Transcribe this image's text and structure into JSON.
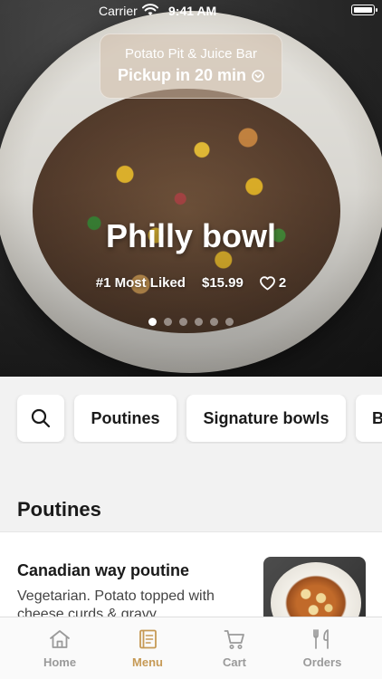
{
  "status_bar": {
    "carrier": "Carrier",
    "time": "9:41 AM"
  },
  "pickup": {
    "store": "Potato Pit & Juice Bar",
    "time_label": "Pickup in 20 min"
  },
  "featured": {
    "title": "Philly bowl",
    "badge": "#1 Most Liked",
    "price": "$15.99",
    "likes": "2",
    "slide_count": 6,
    "active_slide": 1
  },
  "categories": [
    {
      "label": "Poutines"
    },
    {
      "label": "Signature bowls"
    },
    {
      "label": "Burgers"
    }
  ],
  "section": {
    "title": "Poutines"
  },
  "menu_items": [
    {
      "name": "Canadian way poutine",
      "description": "Vegetarian. Potato topped with cheese curds & gravy"
    }
  ],
  "tabs": [
    {
      "label": "Home",
      "icon": "home-icon"
    },
    {
      "label": "Menu",
      "icon": "menu-icon",
      "active": true
    },
    {
      "label": "Cart",
      "icon": "cart-icon"
    },
    {
      "label": "Orders",
      "icon": "orders-icon"
    }
  ],
  "colors": {
    "accent": "#c69a56",
    "inactive": "#9a9a9a"
  }
}
